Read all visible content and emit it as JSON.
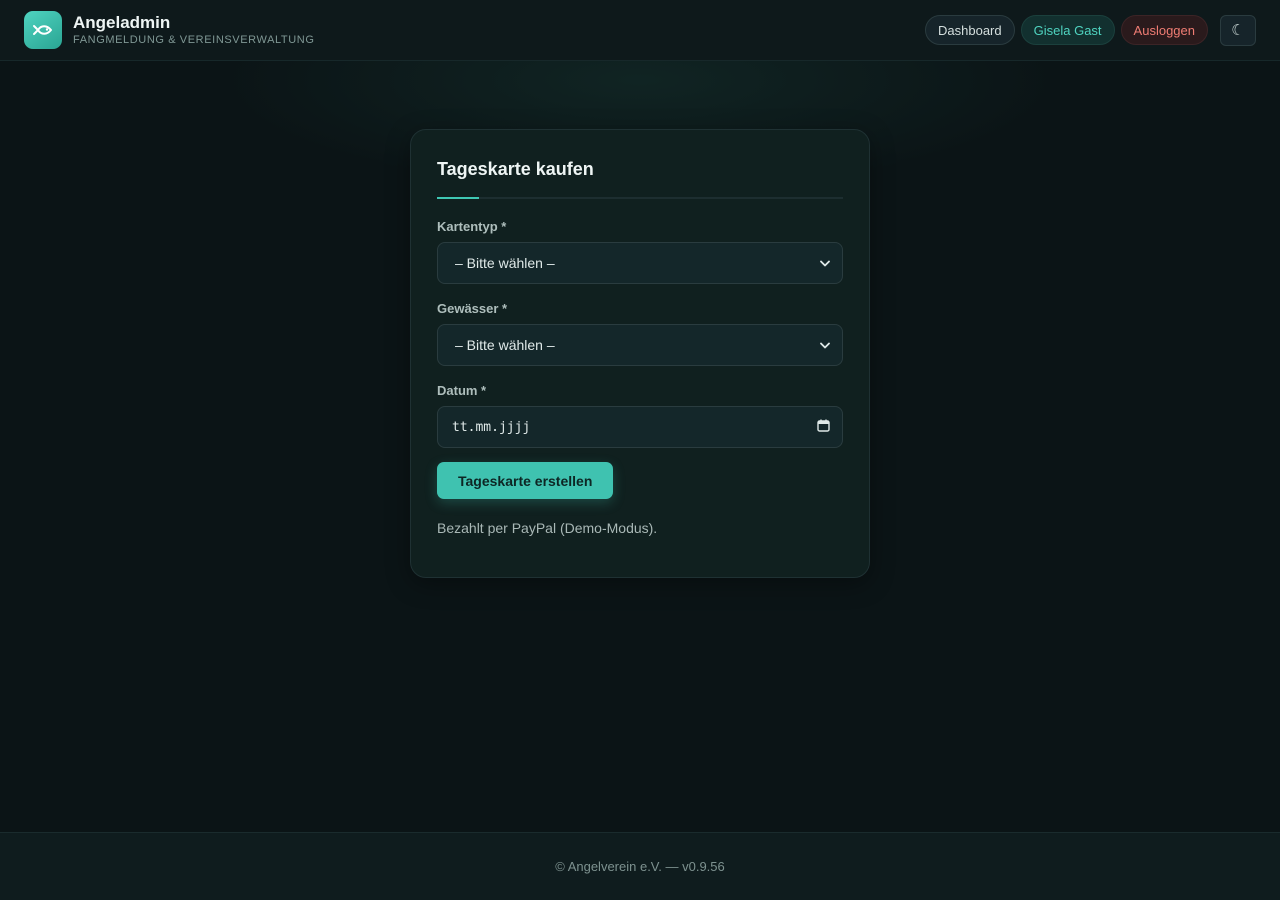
{
  "header": {
    "brand_title": "Angeladmin",
    "brand_subtitle": "FANGMELDUNG & VEREINSVERWALTUNG",
    "logo_icon": "fish-icon",
    "nav": {
      "dashboard": "Dashboard",
      "user": "Gisela Gast",
      "logout": "Ausloggen",
      "theme_toggle": "☾"
    }
  },
  "form": {
    "title": "Tageskarte kaufen",
    "fields": {
      "kartentyp": {
        "label": "Kartentyp *",
        "value": "– Bitte wählen –"
      },
      "gewaesser": {
        "label": "Gewässer *",
        "value": "– Bitte wählen –"
      },
      "datum": {
        "label": "Datum *",
        "placeholder": "tt.mm.jjjj"
      }
    },
    "submit_label": "Tageskarte erstellen",
    "note": "Bezahlt per PayPal (Demo-Modus)."
  },
  "footer": {
    "text": "© Angelverein e.V. — v0.9.56"
  },
  "colors": {
    "background": "#0b1416",
    "card": "#10201f",
    "accent": "#3fc2b0",
    "logout": "#ef7c73"
  }
}
